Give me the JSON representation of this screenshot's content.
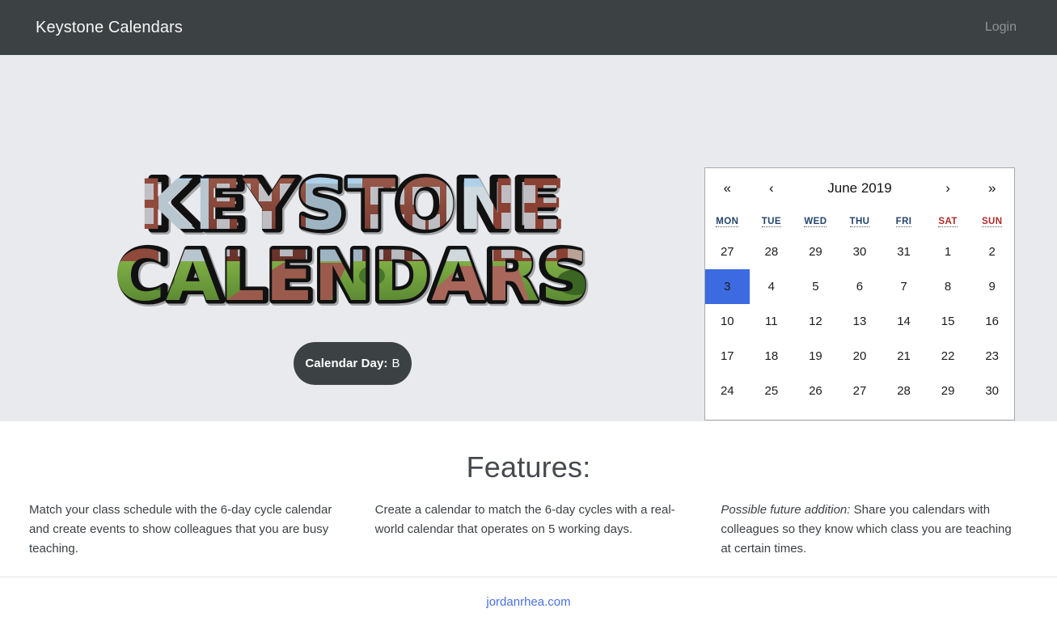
{
  "navbar": {
    "brand": "Keystone Calendars",
    "login_label": "Login"
  },
  "hero": {
    "logo_line1": "KEYSTONE",
    "logo_line2": "CALENDARS",
    "logo_alt": "Keystone Calendars photo-filled wordmark",
    "day_badge_label": "Calendar Day:",
    "day_badge_value": "B"
  },
  "calendar": {
    "title": "June 2019",
    "nav": {
      "prev_year": "«",
      "prev_month": "‹",
      "next_month": "›",
      "next_year": "»"
    },
    "day_headers": [
      "MON",
      "TUE",
      "WED",
      "THU",
      "FRI",
      "SAT",
      "SUN"
    ],
    "weeks": [
      [
        {
          "day": "27",
          "muted": true,
          "weekend": false,
          "active": false
        },
        {
          "day": "28",
          "muted": true,
          "weekend": false,
          "active": false
        },
        {
          "day": "29",
          "muted": true,
          "weekend": false,
          "active": false
        },
        {
          "day": "30",
          "muted": true,
          "weekend": false,
          "active": false
        },
        {
          "day": "31",
          "muted": true,
          "weekend": false,
          "active": false
        },
        {
          "day": "1",
          "muted": false,
          "weekend": true,
          "active": false
        },
        {
          "day": "2",
          "muted": false,
          "weekend": true,
          "active": false
        }
      ],
      [
        {
          "day": "3",
          "muted": false,
          "weekend": false,
          "active": true
        },
        {
          "day": "4",
          "muted": false,
          "weekend": false,
          "active": false
        },
        {
          "day": "5",
          "muted": false,
          "weekend": false,
          "active": false
        },
        {
          "day": "6",
          "muted": false,
          "weekend": false,
          "active": false
        },
        {
          "day": "7",
          "muted": false,
          "weekend": false,
          "active": false
        },
        {
          "day": "8",
          "muted": false,
          "weekend": true,
          "active": false
        },
        {
          "day": "9",
          "muted": false,
          "weekend": true,
          "active": false
        }
      ],
      [
        {
          "day": "10",
          "muted": false,
          "weekend": false,
          "active": false
        },
        {
          "day": "11",
          "muted": false,
          "weekend": false,
          "active": false
        },
        {
          "day": "12",
          "muted": false,
          "weekend": false,
          "active": false
        },
        {
          "day": "13",
          "muted": false,
          "weekend": false,
          "active": false
        },
        {
          "day": "14",
          "muted": false,
          "weekend": false,
          "active": false
        },
        {
          "day": "15",
          "muted": false,
          "weekend": true,
          "active": false
        },
        {
          "day": "16",
          "muted": false,
          "weekend": true,
          "active": false
        }
      ],
      [
        {
          "day": "17",
          "muted": false,
          "weekend": false,
          "active": false
        },
        {
          "day": "18",
          "muted": false,
          "weekend": false,
          "active": false
        },
        {
          "day": "19",
          "muted": false,
          "weekend": false,
          "active": false
        },
        {
          "day": "20",
          "muted": false,
          "weekend": false,
          "active": false
        },
        {
          "day": "21",
          "muted": false,
          "weekend": false,
          "active": false
        },
        {
          "day": "22",
          "muted": false,
          "weekend": true,
          "active": false
        },
        {
          "day": "23",
          "muted": false,
          "weekend": true,
          "active": false
        }
      ],
      [
        {
          "day": "24",
          "muted": false,
          "weekend": false,
          "active": false
        },
        {
          "day": "25",
          "muted": false,
          "weekend": false,
          "active": false
        },
        {
          "day": "26",
          "muted": false,
          "weekend": false,
          "active": false
        },
        {
          "day": "27",
          "muted": false,
          "weekend": false,
          "active": false
        },
        {
          "day": "28",
          "muted": false,
          "weekend": false,
          "active": false
        },
        {
          "day": "29",
          "muted": false,
          "weekend": true,
          "active": false
        },
        {
          "day": "30",
          "muted": false,
          "weekend": true,
          "active": false
        }
      ]
    ]
  },
  "features": {
    "title": "Features:",
    "columns": [
      {
        "lead": "",
        "text": "Match your class schedule with the 6-day cycle calendar and create events to show colleagues that you are busy teaching."
      },
      {
        "lead": "",
        "text": "Create a calendar to match the 6-day cycles with a real-world calendar that operates on 5 working days."
      },
      {
        "lead": "Possible future addition:",
        "text": "Share you calendars with colleagues so they know which class you are teaching at certain times."
      }
    ]
  },
  "footer": {
    "link_text": "jordanrhea.com"
  },
  "colors": {
    "navbar_bg": "#3c4143",
    "jumbotron_bg": "#e9eaee",
    "active_day": "#3c6ae0",
    "weekend_day": "#f0142f",
    "link": "#4a6fe3",
    "badge_bg": "#3c4143"
  }
}
